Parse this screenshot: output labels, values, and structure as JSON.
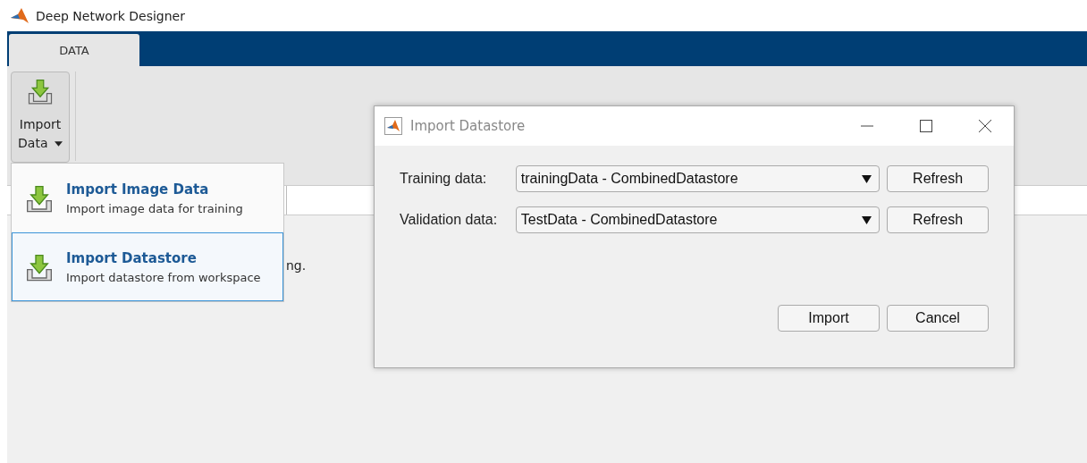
{
  "window": {
    "title": "Deep Network Designer"
  },
  "tabs": [
    {
      "label": "DATA",
      "selected": true
    }
  ],
  "toolstrip": {
    "import_button": {
      "label_line_1": "Import",
      "label_line_2": "Data"
    }
  },
  "content": {
    "text_fragment": "ng."
  },
  "import_menu": {
    "items": [
      {
        "title": "Import Image Data",
        "description": "Import image data for training",
        "selected": false
      },
      {
        "title": "Import Datastore",
        "description": "Import datastore from workspace",
        "selected": true
      }
    ]
  },
  "dialog": {
    "title": "Import Datastore",
    "rows": [
      {
        "label": "Training data:",
        "value": "trainingData - CombinedDatastore",
        "button": "Refresh"
      },
      {
        "label": "Validation data:",
        "value": "TestData - CombinedDatastore",
        "button": "Refresh"
      }
    ],
    "buttons": [
      "Import",
      "Cancel"
    ]
  }
}
